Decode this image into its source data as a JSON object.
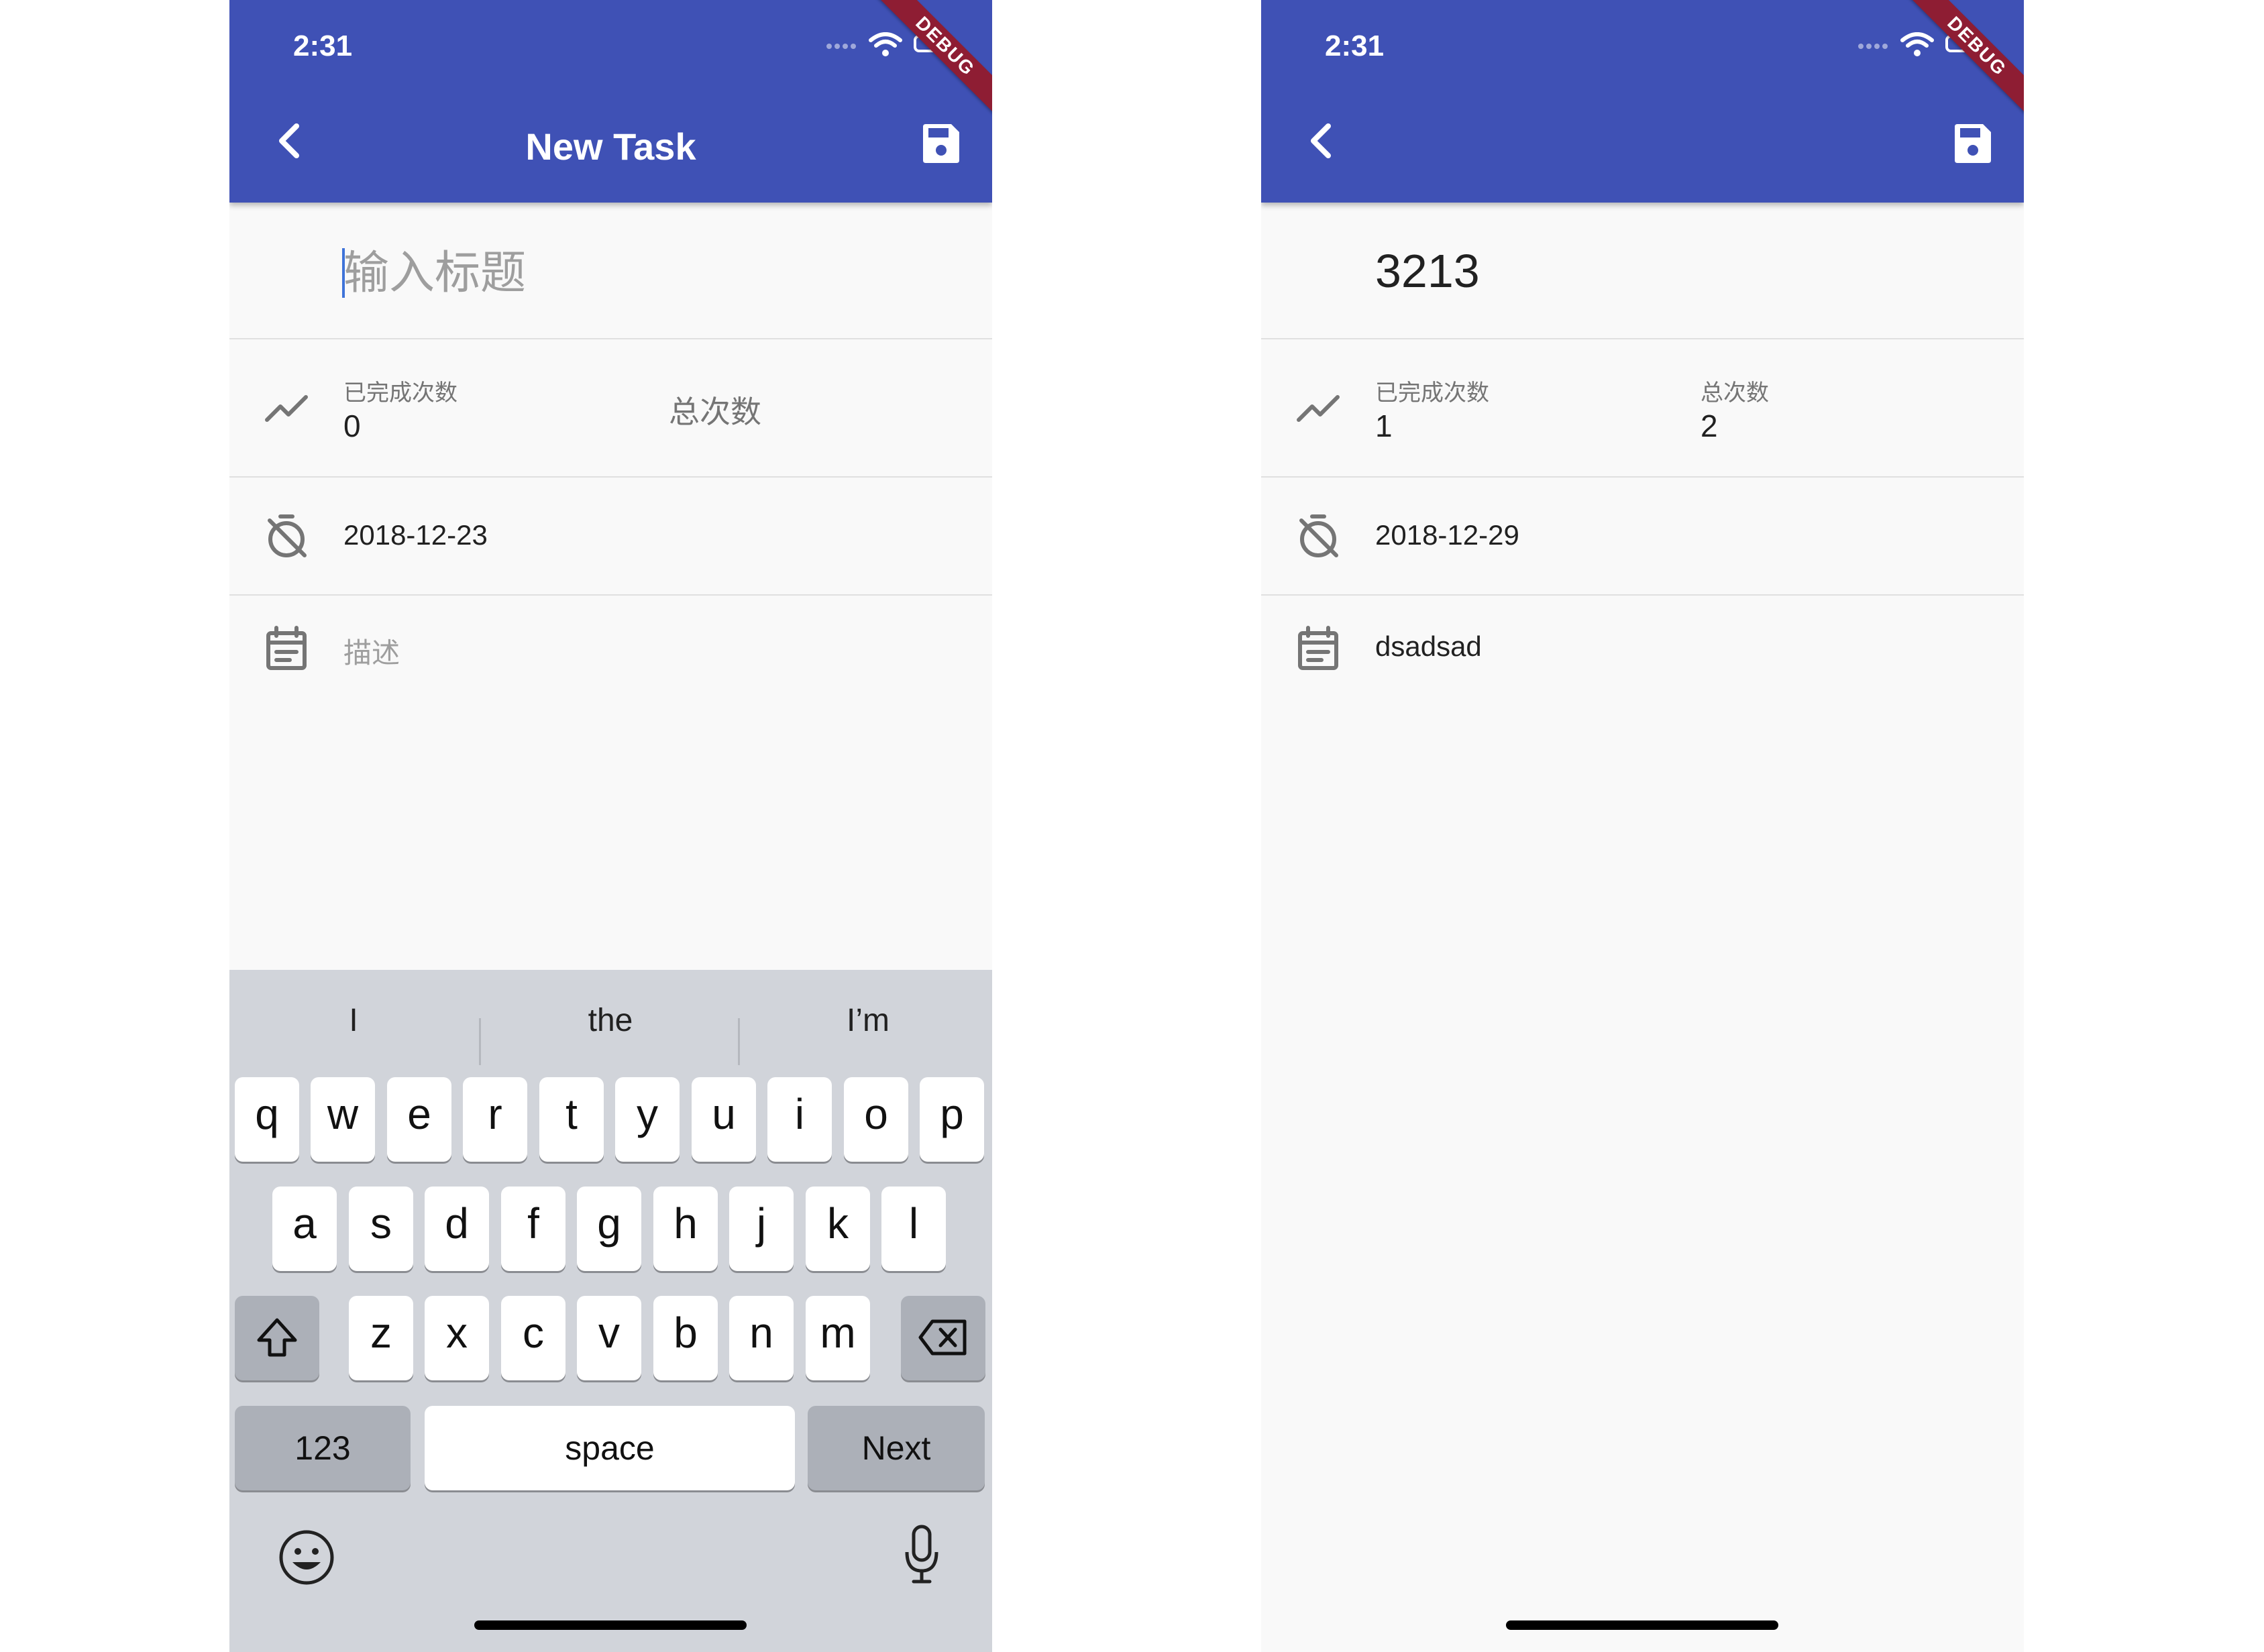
{
  "status": {
    "time": "2:31",
    "debug_banner": "DEBUG"
  },
  "left": {
    "title": "New Task",
    "title_placeholder": "输入标题",
    "completed_label": "已完成次数",
    "completed_value": "0",
    "total_placeholder": "总次数",
    "date": "2018-12-23",
    "description_placeholder": "描述",
    "keyboard": {
      "suggestions": [
        "I",
        "the",
        "I’m"
      ],
      "row1": [
        "q",
        "w",
        "e",
        "r",
        "t",
        "y",
        "u",
        "i",
        "o",
        "p"
      ],
      "row2": [
        "a",
        "s",
        "d",
        "f",
        "g",
        "h",
        "j",
        "k",
        "l"
      ],
      "row3": [
        "z",
        "x",
        "c",
        "v",
        "b",
        "n",
        "m"
      ],
      "numbers_label": "123",
      "space_label": "space",
      "next_label": "Next"
    }
  },
  "right": {
    "title_value": "3213",
    "completed_label": "已完成次数",
    "completed_value": "1",
    "total_label": "总次数",
    "total_value": "2",
    "date": "2018-12-29",
    "description": "dsadsad"
  },
  "colors": {
    "appbar": "#3f51b5",
    "banner": "#8e1d33",
    "keyboard_bg": "#d1d4da"
  },
  "icons": [
    "back-arrow-icon",
    "save-icon",
    "trending-icon",
    "timer-off-icon",
    "event-note-icon",
    "shift-icon",
    "backspace-icon",
    "emoji-icon",
    "microphone-icon"
  ]
}
